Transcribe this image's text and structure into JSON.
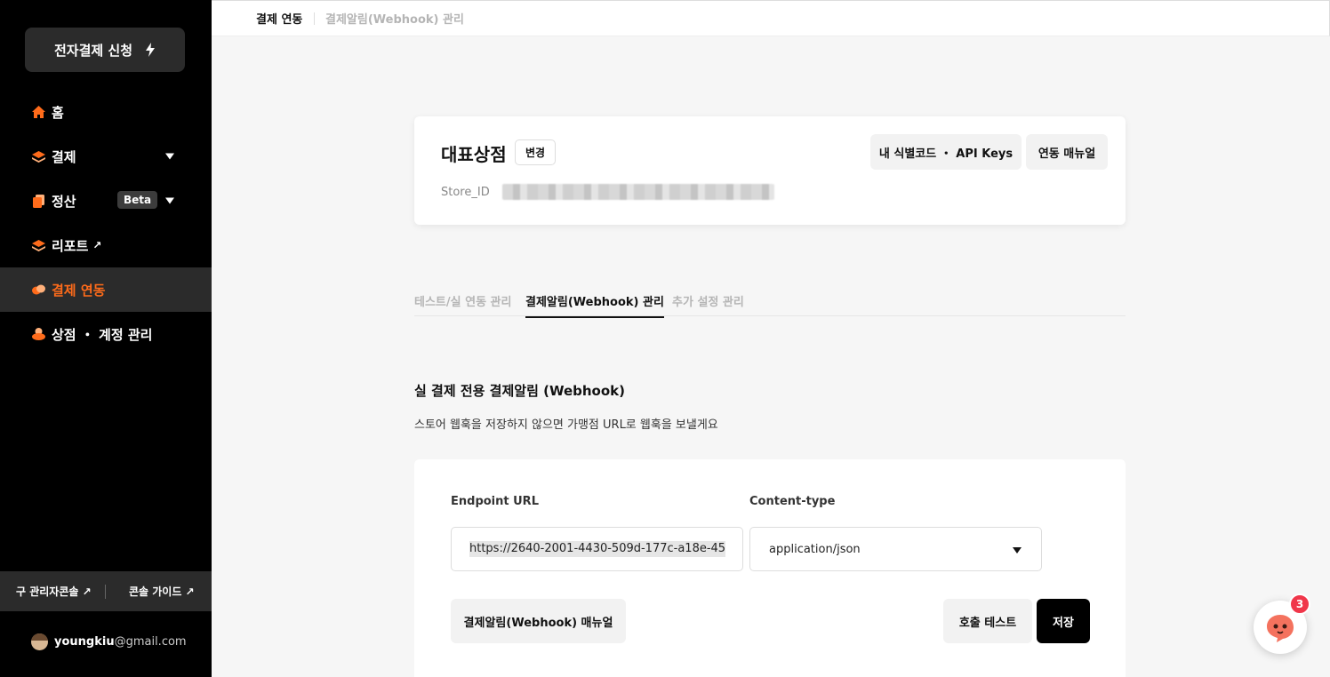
{
  "sidebar": {
    "apply_button": "전자결제 신청",
    "items": [
      {
        "label": "홈",
        "icon": "home-icon"
      },
      {
        "label": "결제",
        "icon": "layers-icon",
        "expandable": true
      },
      {
        "label": "정산",
        "icon": "document-icon",
        "badge": "Beta",
        "expandable": true
      },
      {
        "label": "리포트",
        "icon": "layers-icon",
        "external": "↗"
      },
      {
        "label": "결제 연동",
        "icon": "link-icon",
        "active": true
      },
      {
        "label": "상점 ・ 계정 관리",
        "icon": "store-icon"
      }
    ],
    "footer": {
      "legacy_console": "구 관리자콘솔 ↗",
      "console_guide": "콘솔 가이드 ↗"
    },
    "user": {
      "name": "youngkiu",
      "domain": "@gmail.com"
    }
  },
  "breadcrumb": {
    "current": "결제 연동",
    "sub": "결제알림(Webhook) 관리"
  },
  "store_card": {
    "title": "대표상점",
    "change_button": "변경",
    "store_id_label": "Store_ID",
    "api_keys_button": "내 식별코드 ・ API Keys",
    "manual_button": "연동 매뉴얼"
  },
  "tabs": [
    {
      "label": "테스트/실 연동 관리",
      "active": false
    },
    {
      "label": "결제알림(Webhook) 관리",
      "active": true
    },
    {
      "label": "추가 설정 관리",
      "active": false
    }
  ],
  "section": {
    "title": "실 결제 전용 결제알림 (Webhook)",
    "description": "스토어 웹훅을 저장하지 않으면 가맹점 URL로 웹훅을 보낼게요"
  },
  "form": {
    "endpoint_label": "Endpoint URL",
    "endpoint_value": "https://2640-2001-4430-509d-177c-a18e-45",
    "content_type_label": "Content-type",
    "content_type_value": "application/json",
    "webhook_manual_button": "결제알림(Webhook) 매뉴얼",
    "test_button": "호출 테스트",
    "save_button": "저장"
  },
  "chat": {
    "badge_count": "3"
  },
  "colors": {
    "accent": "#ff6b1a",
    "sidebar_bg": "#000000",
    "badge": "#f0364a"
  }
}
